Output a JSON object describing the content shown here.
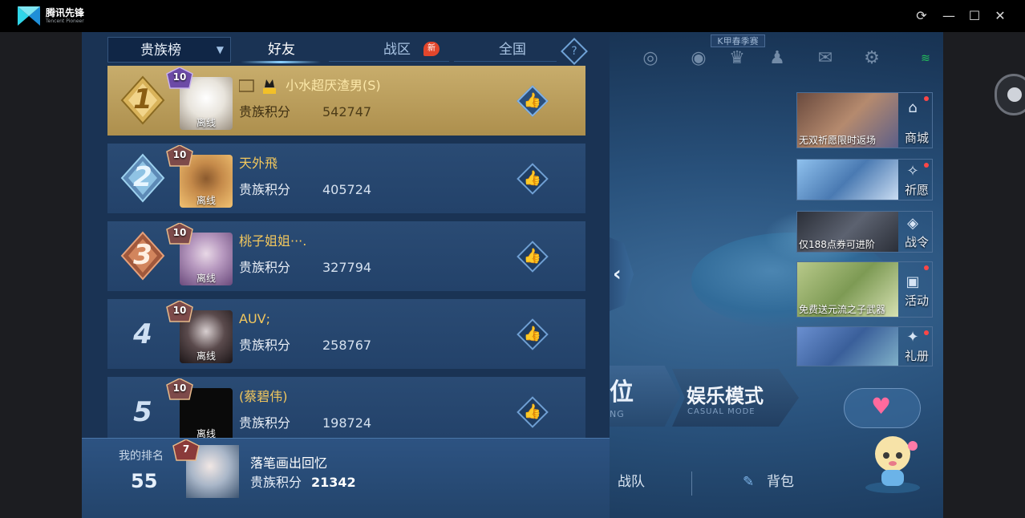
{
  "emulator": {
    "app_name": "腾讯先锋",
    "app_subtitle": "Tencent Pioneer",
    "controls": {
      "refresh": "⟳",
      "minimize": "—",
      "maximize": "☐",
      "close": "✕"
    }
  },
  "game_bg": {
    "season_tag": "K甲春季赛",
    "banners": [
      {
        "caption": "无双祈愿限时返场",
        "label": "商城",
        "icon": "shop-icon",
        "color": "#8a5a3c"
      },
      {
        "caption": "",
        "label": "祈愿",
        "icon": "wish-icon",
        "color": "#4a7ab2"
      },
      {
        "caption": "仅188点券可进阶",
        "label": "战令",
        "icon": "battle-pass-icon",
        "color": "#3c4454"
      },
      {
        "caption": "免费送元流之子武器",
        "label": "活动",
        "icon": "event-icon",
        "color": "#7d9a54"
      },
      {
        "caption": "",
        "label": "礼册",
        "icon": "gift-book-icon",
        "color": "#5a7fb0"
      }
    ],
    "mode_ranked": "位",
    "mode_ranked_sub": "NG",
    "mode_casual": "娱乐模式",
    "mode_casual_sub": "CASUAL MODE",
    "bottom_team": "战队",
    "bottom_bag": "背包",
    "bag_icon": "bag-icon"
  },
  "leaderboard": {
    "dropdown_label": "贵族榜",
    "tabs": [
      "好友",
      "战区",
      "全国"
    ],
    "active_tab": "好友",
    "new_badge": "新",
    "help": "?",
    "rows": [
      {
        "rank": "1",
        "vip": "10",
        "name": "小水超厌渣男(S)",
        "label": "贵族积分",
        "score": "542747",
        "status": "离线",
        "like_icon": "thumbs-up-icon"
      },
      {
        "rank": "2",
        "vip": "10",
        "name": "天外飛",
        "label": "贵族积分",
        "score": "405724",
        "status": "离线",
        "like_icon": "thumbs-up-icon"
      },
      {
        "rank": "3",
        "vip": "10",
        "name": "桃子姐姐···.",
        "label": "贵族积分",
        "score": "327794",
        "status": "离线",
        "like_icon": "thumbs-up-icon"
      },
      {
        "rank": "4",
        "vip": "10",
        "name": "AUV;",
        "label": "贵族积分",
        "score": "258767",
        "status": "离线",
        "like_icon": "thumbs-up-icon"
      },
      {
        "rank": "5",
        "vip": "10",
        "name": "(蔡碧伟)",
        "label": "贵族积分",
        "score": "198724",
        "status": "离线",
        "like_icon": "thumbs-up-icon"
      }
    ],
    "my_rank": {
      "label": "我的排名",
      "rank": "55",
      "vip": "7",
      "name": "落笔画出回忆",
      "score_label": "贵族积分",
      "score": "21342"
    },
    "svip_tag": "SVIP"
  }
}
